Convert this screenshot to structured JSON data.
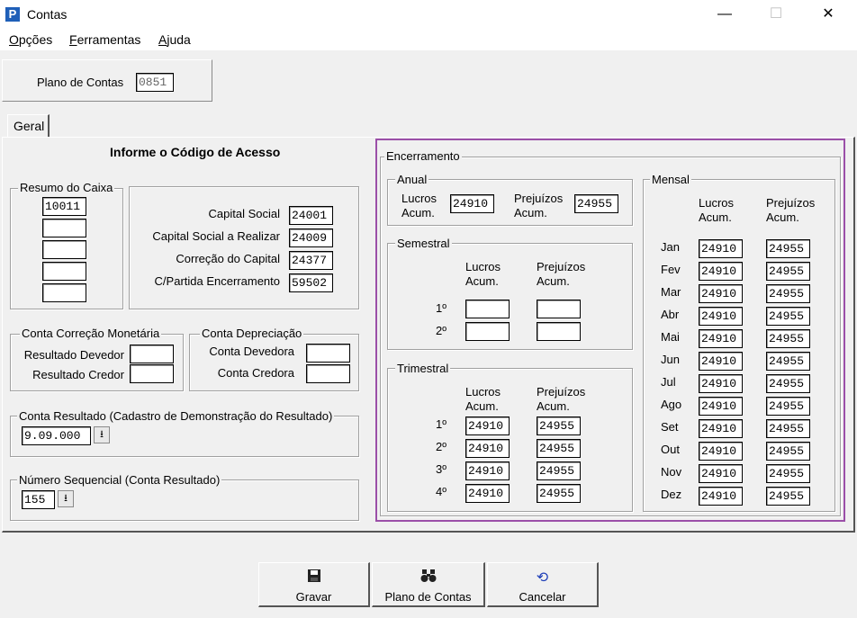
{
  "window": {
    "title": "Contas",
    "minimize": "—",
    "maximize": "☐",
    "close": "✕"
  },
  "menu": [
    {
      "label": "Opções",
      "key": "O",
      "rest": "pções"
    },
    {
      "label": "Ferramentas",
      "key": "F",
      "rest": "erramentas"
    },
    {
      "label": "Ajuda",
      "key": "A",
      "rest": "juda"
    }
  ],
  "plano": {
    "label": "Plano de Contas",
    "value": "0851"
  },
  "tab": "Geral",
  "heading": "Informe o Código de Acesso",
  "resumo": {
    "title": "Resumo do Caixa",
    "values": [
      "10011",
      "",
      "",
      "",
      ""
    ]
  },
  "capital": {
    "rows": [
      {
        "label": "Capital Social",
        "value": "24001"
      },
      {
        "label": "Capital Social a Realizar",
        "value": "24009"
      },
      {
        "label": "Correção do Capital",
        "value": "24377"
      },
      {
        "label": "C/Partida Encerramento",
        "value": "59502"
      }
    ]
  },
  "correcao": {
    "title": "Conta Correção Monetária",
    "devedor_label": "Resultado Devedor",
    "devedor_value": "",
    "credor_label": "Resultado Credor",
    "credor_value": ""
  },
  "depreciacao": {
    "title": "Conta Depreciação",
    "devedora_label": "Conta Devedora",
    "devedora_value": "",
    "credora_label": "Conta Credora",
    "credora_value": ""
  },
  "resultado": {
    "title": "Conta Resultado (Cadastro de Demonstração do Resultado)",
    "value": "9.09.000"
  },
  "sequencial": {
    "title": "Número Sequencial (Conta Resultado)",
    "value": "155"
  },
  "encerramento": {
    "title": "Encerramento",
    "lucros_l1": "Lucros",
    "lucros_l2": "Acum.",
    "prej_l1": "Prejuízos",
    "prej_l2": "Acum.",
    "anual": {
      "title": "Anual",
      "lucros": "24910",
      "prejuizos": "24955"
    },
    "semestral": {
      "title": "Semestral",
      "rows": [
        {
          "label": "1º",
          "lucros": "",
          "prejuizos": ""
        },
        {
          "label": "2º",
          "lucros": "",
          "prejuizos": ""
        }
      ]
    },
    "trimestral": {
      "title": "Trimestral",
      "rows": [
        {
          "label": "1º",
          "lucros": "24910",
          "prejuizos": "24955"
        },
        {
          "label": "2º",
          "lucros": "24910",
          "prejuizos": "24955"
        },
        {
          "label": "3º",
          "lucros": "24910",
          "prejuizos": "24955"
        },
        {
          "label": "4º",
          "lucros": "24910",
          "prejuizos": "24955"
        }
      ]
    },
    "mensal": {
      "title": "Mensal",
      "rows": [
        {
          "label": "Jan",
          "lucros": "24910",
          "prejuizos": "24955"
        },
        {
          "label": "Fev",
          "lucros": "24910",
          "prejuizos": "24955"
        },
        {
          "label": "Mar",
          "lucros": "24910",
          "prejuizos": "24955"
        },
        {
          "label": "Abr",
          "lucros": "24910",
          "prejuizos": "24955"
        },
        {
          "label": "Mai",
          "lucros": "24910",
          "prejuizos": "24955"
        },
        {
          "label": "Jun",
          "lucros": "24910",
          "prejuizos": "24955"
        },
        {
          "label": "Jul",
          "lucros": "24910",
          "prejuizos": "24955"
        },
        {
          "label": "Ago",
          "lucros": "24910",
          "prejuizos": "24955"
        },
        {
          "label": "Set",
          "lucros": "24910",
          "prejuizos": "24955"
        },
        {
          "label": "Out",
          "lucros": "24910",
          "prejuizos": "24955"
        },
        {
          "label": "Nov",
          "lucros": "24910",
          "prejuizos": "24955"
        },
        {
          "label": "Dez",
          "lucros": "24910",
          "prejuizos": "24955"
        }
      ]
    }
  },
  "buttons": {
    "gravar": {
      "label": "Gravar",
      "icon": "floppy-disk-icon"
    },
    "plano": {
      "label": "Plano de Contas",
      "icon": "binoculars-icon"
    },
    "cancelar": {
      "label": "Cancelar",
      "icon": "undo-icon"
    }
  },
  "colors": {
    "highlight": "#9b4fa8",
    "title_icon": "#1f5fb8"
  }
}
